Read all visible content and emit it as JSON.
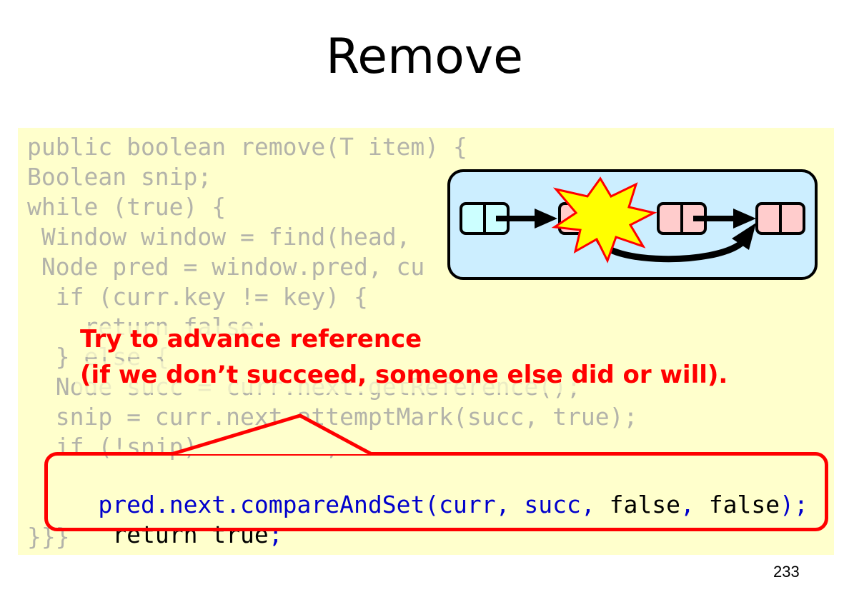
{
  "slide": {
    "title": "Remove",
    "page_number": "233"
  },
  "code": {
    "lines": [
      "public boolean remove(T item) {",
      "Boolean snip;",
      "while (true) {",
      " Window window = find(head,",
      " Node pred = window.pred, cu",
      "  if (curr.key != key) {",
      "    return false;",
      "  } else {",
      "  Node succ = curr.next.getReference();",
      "  snip = curr.next.attemptMark(succ, true);",
      "  if (!snip) continue;",
      "",
      "",
      "}}}"
    ],
    "highlight_line_1": {
      "indent": "   ",
      "parts": [
        "pred.next.compareAndSet(curr",
        ", ",
        "succ",
        ", ",
        "false",
        ", ",
        "false",
        ");"
      ]
    },
    "highlight_line_2": {
      "indent": "    ",
      "parts": [
        "return true",
        ";"
      ]
    }
  },
  "annotation": {
    "line1": "Try to advance reference",
    "line2": "(if we don’t succeed, someone else did or will)."
  },
  "diagram": {
    "node_colors": [
      "#ccffff",
      "#ffcccc",
      "#ffcccc",
      "#ffcccc"
    ],
    "burst_color": "#ffff00",
    "burst_outline": "#ff0000"
  }
}
